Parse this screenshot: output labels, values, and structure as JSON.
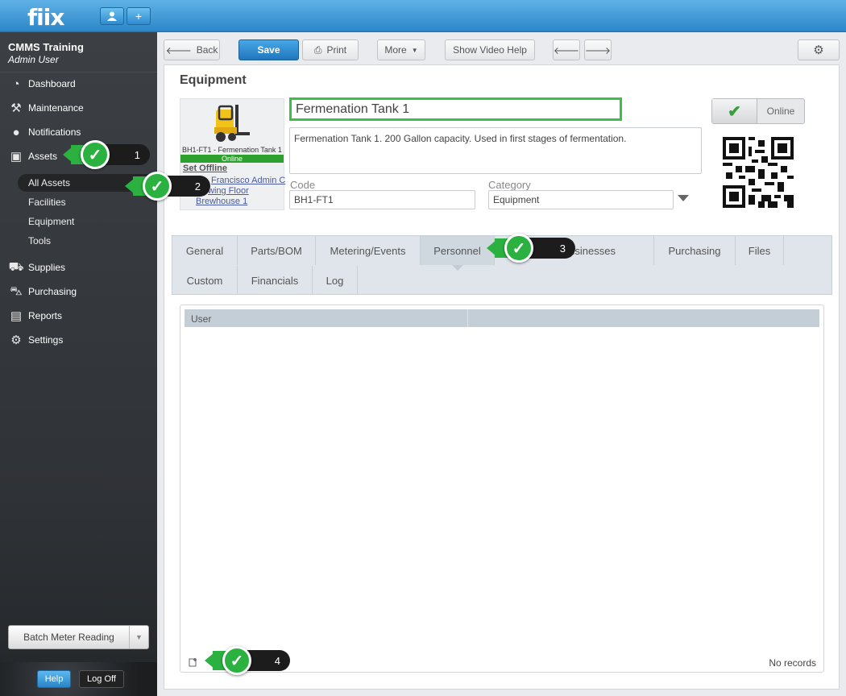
{
  "app": {
    "logo": "fiix"
  },
  "topbar": {
    "user_icon": "user-icon",
    "add_label": "+"
  },
  "sidebar": {
    "org_name": "CMMS Training",
    "user_role": "Admin User",
    "nav": [
      {
        "label": "Dashboard",
        "icon": "dashboard-icon"
      },
      {
        "label": "Maintenance",
        "icon": "tools-icon"
      },
      {
        "label": "Notifications",
        "icon": "chat-bubble-icon"
      },
      {
        "label": "Assets",
        "icon": "box-icon"
      },
      {
        "label": "Supplies",
        "icon": "truck-icon"
      },
      {
        "label": "Purchasing",
        "icon": "cart-icon"
      },
      {
        "label": "Reports",
        "icon": "chart-icon"
      },
      {
        "label": "Settings",
        "icon": "gear-icon"
      }
    ],
    "asset_sub": [
      "All Assets",
      "Facilities",
      "Equipment",
      "Tools"
    ],
    "batch_label": "Batch Meter Reading",
    "help_label": "Help",
    "logoff_label": "Log Off"
  },
  "toolbar": {
    "back": "Back",
    "save": "Save",
    "print": "Print",
    "more": "More",
    "video_help": "Show Video Help"
  },
  "record": {
    "section_title": "Equipment",
    "name": "Fermenation Tank 1",
    "description": "Fermenation Tank 1. 200 Gallon capacity. Used in first stages of fermentation.",
    "card_caption": "BH1-FT1 - Fermenation Tank 1",
    "card_status": "Online",
    "set_offline": "Set Offline",
    "loc1": "Francisco Admin C",
    "loc2": "wing Floor",
    "loc3": "Brewhouse 1",
    "code_label": "Code",
    "code": "BH1-FT1",
    "category_label": "Category",
    "category": "Equipment",
    "online_label": "Online"
  },
  "tabs": {
    "row1": [
      "General",
      "Parts/BOM",
      "Metering/Events",
      "Personnel",
      "Businesses",
      "Purchasing",
      "Files"
    ],
    "row2": [
      "Custom",
      "Financials",
      "Log"
    ],
    "active": "Personnel"
  },
  "grid": {
    "columns": [
      "User",
      ""
    ],
    "empty_text": "No records"
  },
  "callouts": [
    "1",
    "2",
    "3",
    "4"
  ],
  "colors": {
    "accent": "#2c86c8",
    "highlight": "#3cbf4a",
    "status_online": "#2ea02e"
  }
}
